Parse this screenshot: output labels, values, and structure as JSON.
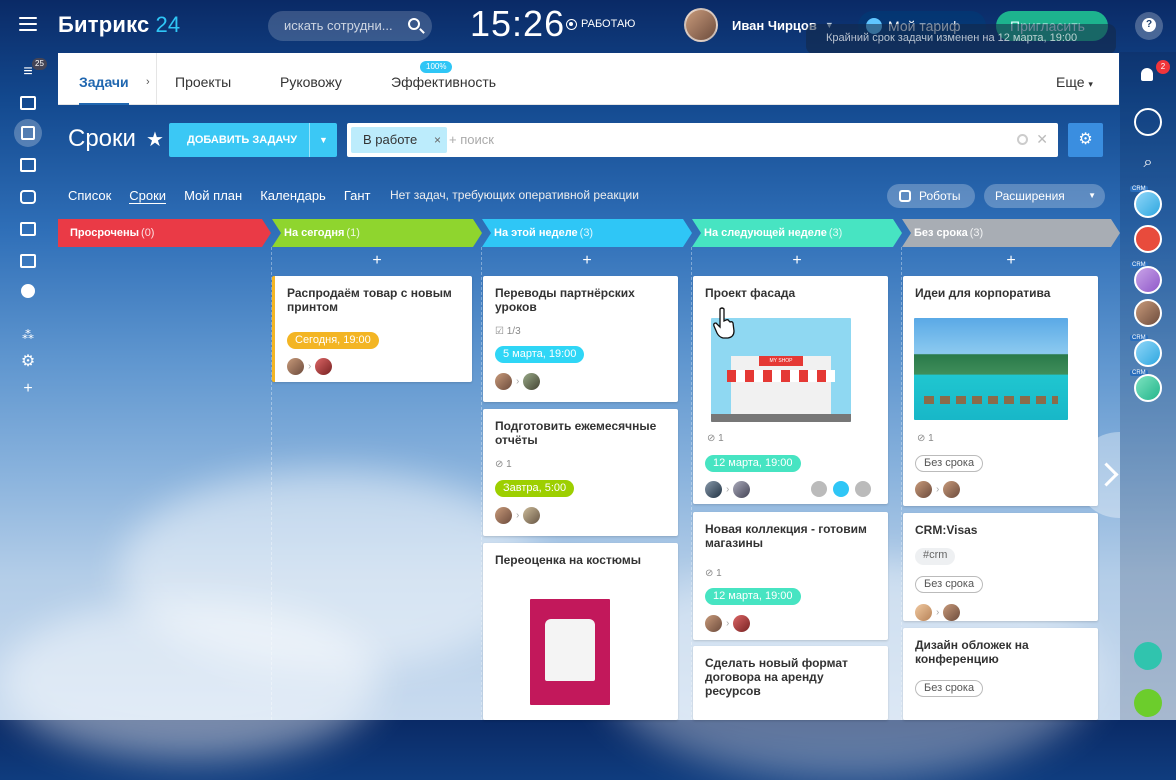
{
  "app": {
    "logo_main": "Битрикс",
    "logo_num": "24"
  },
  "header": {
    "search_placeholder": "искать сотрудни...",
    "clock": "15:26",
    "work_status": "РАБОТАЮ",
    "user_name": "Иван Чирцов",
    "plan_label": "Мой тариф",
    "invite_label": "Пригласить",
    "notice": "Крайний срок задачи изменен на 12 марта, 19:00",
    "help": "?"
  },
  "rail": {
    "filter_badge": "25"
  },
  "right_rail": {
    "bell_badge": "2",
    "crm": "CRM"
  },
  "tabs": [
    {
      "label": "Задачи"
    },
    {
      "label": "Проекты"
    },
    {
      "label": "Руковожу"
    },
    {
      "label": "Эффективность"
    },
    {
      "label": "Еще"
    }
  ],
  "tabs_badge": "100%",
  "toolbar": {
    "page_title": "Сроки",
    "add_button": "ДОБАВИТЬ ЗАДАЧУ",
    "filter_chip": "В работе",
    "filter_placeholder": "+ поиск"
  },
  "views": {
    "items": [
      "Список",
      "Сроки",
      "Мой план",
      "Календарь",
      "Гант"
    ],
    "no_reaction": "Нет задач, требующих оперативной реакции",
    "robots": "Роботы",
    "extensions": "Расширения"
  },
  "columns": [
    {
      "title": "Просрочены",
      "count": "(0)",
      "color": "#ea3a46"
    },
    {
      "title": "На сегодня",
      "count": "(1)",
      "color": "#8fd52e"
    },
    {
      "title": "На этой неделе",
      "count": "(3)",
      "color": "#2fc6f6"
    },
    {
      "title": "На следующей неделе",
      "count": "(3)",
      "color": "#47e4c2"
    },
    {
      "title": "Без срока",
      "count": "(3)",
      "color": "#a8adb4"
    }
  ],
  "plus": "+",
  "cards": {
    "c1": {
      "title": "Распродаём товар с новым принтом",
      "deadline": "Сегодня, 19:00",
      "deadline_color": "#f3b524"
    },
    "c2": {
      "title": "Переводы партнёрских уроков",
      "checklist": "1/3",
      "deadline": "5 марта, 19:00",
      "deadline_color": "#2fd6f6"
    },
    "c3": {
      "title": "Подготовить ежемесячные отчёты",
      "files": "1",
      "deadline": "Завтра, 5:00",
      "deadline_color": "#9dcf00"
    },
    "c4": {
      "title": "Переоценка на костюмы"
    },
    "c5": {
      "title": "Проект фасада",
      "image_text": "MY SHOP",
      "files": "1",
      "deadline": "12 марта, 19:00",
      "deadline_color": "#47e4c2"
    },
    "c6": {
      "title": "Новая коллекция - готовим магазины",
      "files": "1",
      "deadline": "12 марта, 19:00",
      "deadline_color": "#47e4c2"
    },
    "c7": {
      "title": "Сделать новый формат договора на аренду ресурсов"
    },
    "c8": {
      "title": "Идеи для корпоратива",
      "files": "1",
      "tag": "Без срока"
    },
    "c9": {
      "title": "CRM:Visas",
      "hash": "#crm",
      "tag": "Без срока"
    },
    "c10": {
      "title": "Дизайн обложек на конференцию",
      "tag": "Без срока"
    }
  }
}
